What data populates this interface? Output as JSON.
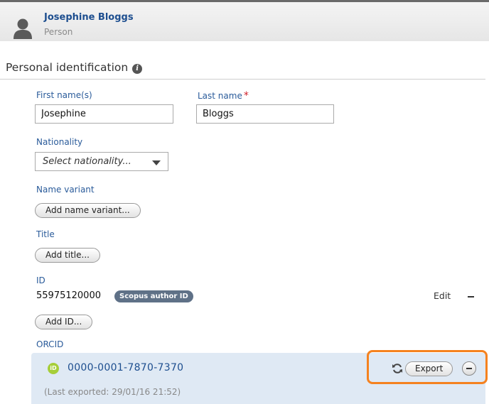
{
  "header": {
    "name": "Josephine Bloggs",
    "type": "Person",
    "avatar_icon": "person-icon"
  },
  "section": {
    "title": "Personal identification",
    "info_icon": "i"
  },
  "form": {
    "first_name": {
      "label": "First name(s)",
      "value": "Josephine"
    },
    "last_name": {
      "label": "Last name",
      "required_marker": "*",
      "value": "Bloggs"
    },
    "nationality": {
      "label": "Nationality",
      "placeholder": "Select nationality..."
    },
    "name_variant": {
      "label": "Name variant",
      "button": "Add name variant..."
    },
    "title": {
      "label": "Title",
      "button": "Add title..."
    },
    "id": {
      "label": "ID",
      "value": "55975120000",
      "badge": "Scopus author ID",
      "edit": "Edit",
      "add_button": "Add ID..."
    },
    "orcid": {
      "label": "ORCID",
      "icon_text": "iD",
      "value": "0000-0001-7870-7370",
      "export_button": "Export",
      "last_exported": "(Last exported: 29/01/16 21:52)"
    }
  },
  "colors": {
    "link_blue": "#1d4e8f",
    "label_blue": "#2a5b9a",
    "required_red": "#d0202a",
    "orcid_green": "#a6ce39",
    "highlight_orange": "#f5821f",
    "panel_blue": "#dfe9f4",
    "badge_slate": "#5f7187"
  }
}
